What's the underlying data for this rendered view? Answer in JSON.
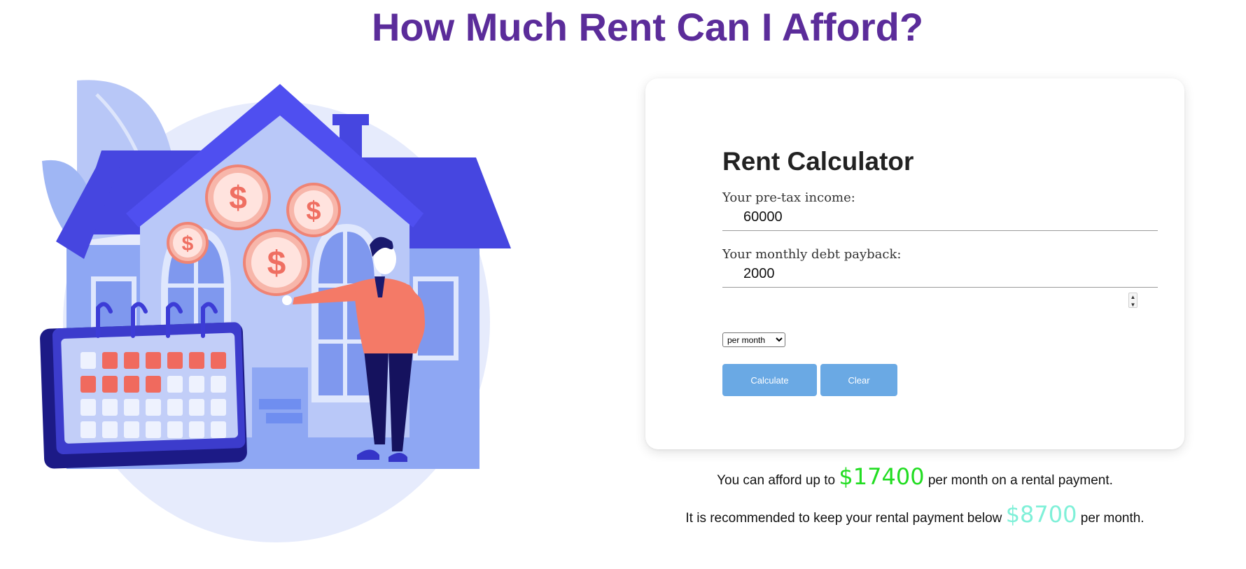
{
  "page": {
    "title": "How Much Rent Can I Afford?"
  },
  "colors": {
    "title": "#5b2c9a",
    "button": "#6aa9e4",
    "max_amount": "#22dd22",
    "recommended_amount": "#7ff0d8"
  },
  "illustration": {
    "icons": [
      "house-icon",
      "calendar-icon",
      "dollar-coin-icon",
      "person-icon",
      "leaf-icon"
    ]
  },
  "calculator": {
    "title": "Rent Calculator",
    "income": {
      "label": "Your pre-tax income:",
      "value": "60000"
    },
    "debt": {
      "label": "Your monthly debt payback:",
      "value": "2000"
    },
    "period": {
      "selected": "per month",
      "options": [
        "per month"
      ]
    },
    "buttons": {
      "calculate": "Calculate",
      "clear": "Clear"
    }
  },
  "results": {
    "max": {
      "prefix": "You can afford up to",
      "amount": "$17400",
      "suffix": "per month on a rental payment."
    },
    "recommended": {
      "prefix": "It is recommended to keep your rental payment below",
      "amount": "$8700",
      "suffix": "per month."
    }
  }
}
